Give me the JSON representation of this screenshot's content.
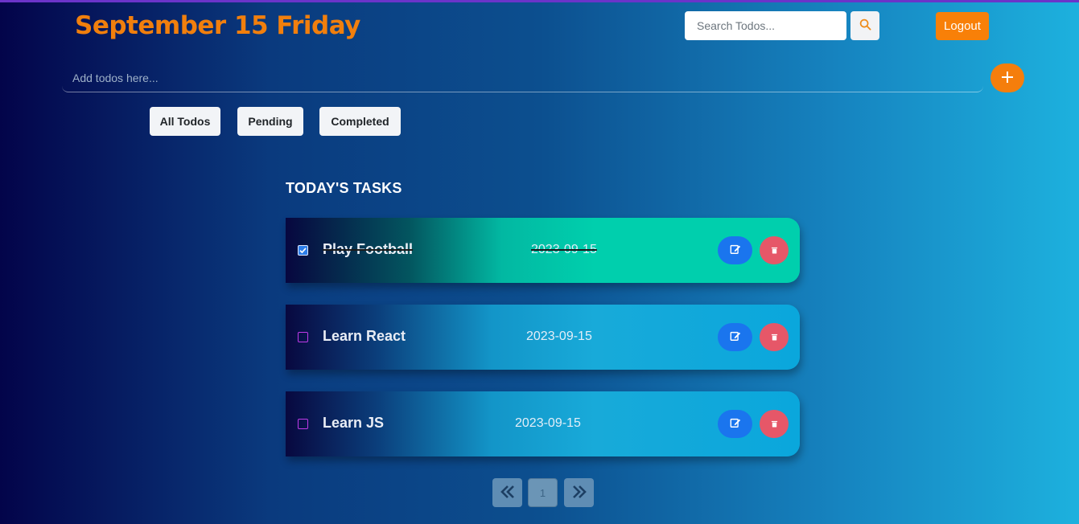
{
  "header": {
    "date_title": "September 15 Friday",
    "search_placeholder": "Search Todos...",
    "search_icon": "search-icon",
    "logout_label": "Logout"
  },
  "add_todo": {
    "placeholder": "Add todos here...",
    "add_icon": "plus-icon"
  },
  "filters": [
    {
      "label": "All Todos"
    },
    {
      "label": "Pending"
    },
    {
      "label": "Completed"
    }
  ],
  "section_title": "TODAY'S TASKS",
  "tasks": [
    {
      "title": "Play Football",
      "date": "2023-09-15",
      "completed": true
    },
    {
      "title": "Learn React",
      "date": "2023-09-15",
      "completed": false
    },
    {
      "title": "Learn JS",
      "date": "2023-09-15",
      "completed": false
    }
  ],
  "task_actions": {
    "edit_icon": "edit-icon",
    "delete_icon": "trash-icon"
  },
  "pagination": {
    "current_page": "1",
    "prev_icon": "double-chevron-left-icon",
    "next_icon": "double-chevron-right-icon"
  },
  "colors": {
    "title_orange": "#f17f0d",
    "logout_orange": "#f88008",
    "edit_blue": "#1a75ee",
    "delete_red": "#e65768",
    "completed_card": "#00cfad",
    "pending_card": "#18aad9"
  }
}
